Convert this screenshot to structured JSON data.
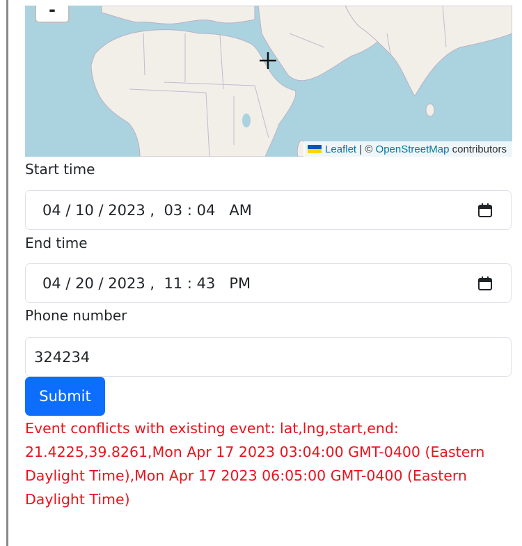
{
  "map": {
    "zoom_out_label": "-",
    "attribution": {
      "leaflet_link": "Leaflet",
      "separator": " | © ",
      "osm_link": "OpenStreetMap",
      "suffix": " contributors"
    }
  },
  "form": {
    "start_time": {
      "label": "Start time",
      "value": "04 / 10 / 2023 ,  03 : 04   AM"
    },
    "end_time": {
      "label": "End time",
      "value": "04 / 20 / 2023 ,  11 : 43   PM"
    },
    "phone": {
      "label": "Phone number",
      "value": "324234"
    },
    "submit_label": "Submit"
  },
  "error": {
    "message": "Event conflicts with existing event: lat,lng,start,end: 21.4225,39.8261,Mon Apr 17 2023 03:04:00 GMT-0400 (Eastern Daylight Time),Mon Apr 17 2023 06:05:00 GMT-0400 (Eastern Daylight Time)"
  },
  "colors": {
    "primary": "#0d6efd",
    "error": "#e8141c",
    "water": "#aad3df",
    "land": "#f2efe9",
    "link": "#0078a8"
  },
  "icons": [
    "minus-icon",
    "crosshair-icon",
    "calendar-icon",
    "ukraine-flag-icon"
  ]
}
